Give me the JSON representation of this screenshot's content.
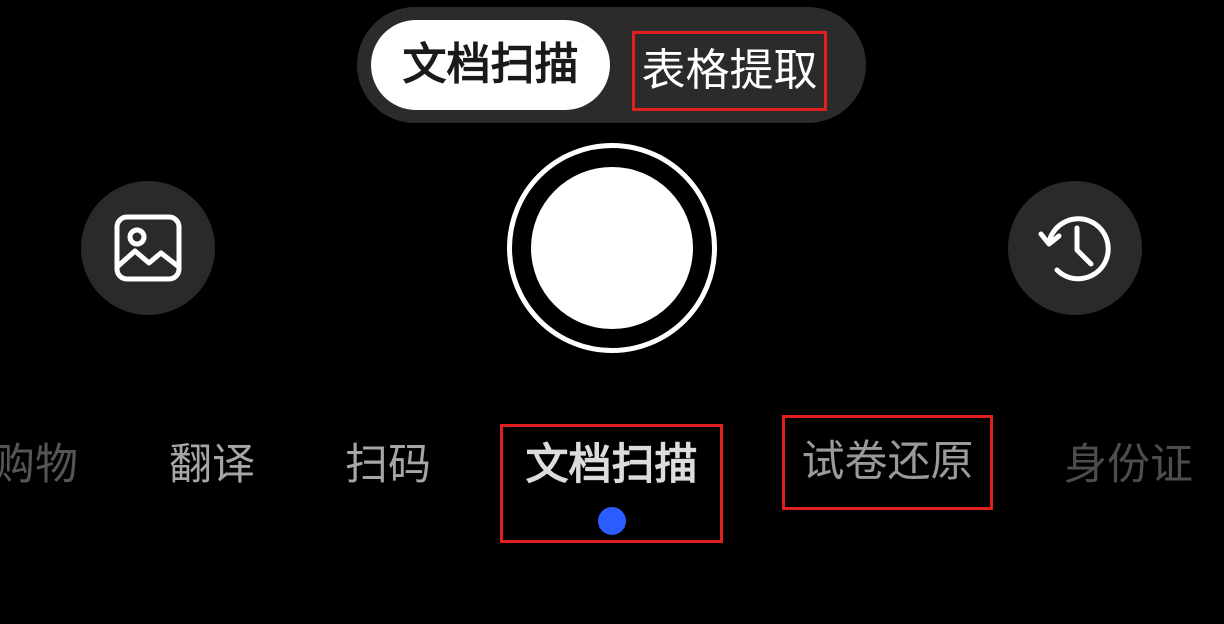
{
  "toggle": {
    "active_label": "文档扫描",
    "inactive_label": "表格提取"
  },
  "icons": {
    "gallery": "image-icon",
    "history": "history-clock-icon"
  },
  "modes": [
    {
      "label": "购物",
      "selected": false
    },
    {
      "label": "翻译",
      "selected": false
    },
    {
      "label": "扫码",
      "selected": false
    },
    {
      "label": "文档扫描",
      "selected": true
    },
    {
      "label": "试卷还原",
      "selected": false
    },
    {
      "label": "身份证",
      "selected": false
    }
  ],
  "colors": {
    "background": "#000000",
    "indicator": "#2a5cff",
    "highlight_box": "#e02020"
  }
}
